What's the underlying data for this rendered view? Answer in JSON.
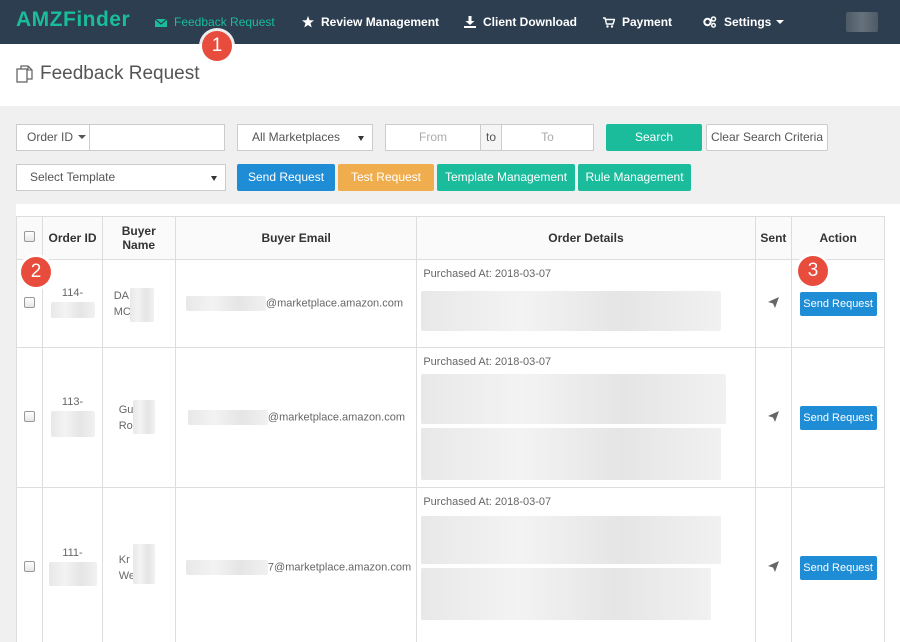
{
  "nav": {
    "brand": "AMZFinder",
    "items": [
      {
        "label": "Feedback Request",
        "icon": "envelope-icon"
      },
      {
        "label": "Review Management",
        "icon": "star-icon"
      },
      {
        "label": "Client Download",
        "icon": "download-icon"
      },
      {
        "label": "Payment",
        "icon": "cart-icon"
      },
      {
        "label": "Settings",
        "icon": "gears-icon"
      }
    ]
  },
  "page": {
    "title": "Feedback Request"
  },
  "filters": {
    "order_id_label": "Order ID",
    "order_id_value": "",
    "marketplace": "All Marketplaces",
    "from_placeholder": "From",
    "to_label": "to",
    "to_placeholder": "To",
    "search_label": "Search",
    "clear_label": "Clear Search Criteria",
    "template": "Select Template",
    "send_request_label": "Send Request",
    "test_request_label": "Test Request",
    "template_management_label": "Template Management",
    "rule_management_label": "Rule Management"
  },
  "table": {
    "columns": [
      "Order ID",
      "Buyer Name",
      "Buyer Email",
      "Order Details",
      "Sent",
      "Action"
    ],
    "rows": [
      {
        "order_id": "114-",
        "buyer_name": [
          "DA",
          "MC"
        ],
        "email_suffix": "@marketplace.amazon.com",
        "purchased": "Purchased At: 2018-03-07",
        "action": "Send Request"
      },
      {
        "order_id": "113-",
        "buyer_name": [
          "Gu",
          "Ro"
        ],
        "email_suffix": "@marketplace.amazon.com",
        "purchased": "Purchased At: 2018-03-07",
        "action": "Send Request"
      },
      {
        "order_id": "111-",
        "buyer_name": [
          "Kr",
          "We"
        ],
        "email_suffix": "7@marketplace.amazon.com",
        "purchased": "Purchased At: 2018-03-07",
        "action": "Send Request"
      }
    ]
  },
  "badges": [
    "1",
    "2",
    "3"
  ],
  "colors": {
    "navbar": "#2c3e50",
    "accent": "#1abc9c",
    "primary": "#1f8dd6",
    "warning": "#f0ad4e",
    "badge": "#e74c3c"
  }
}
